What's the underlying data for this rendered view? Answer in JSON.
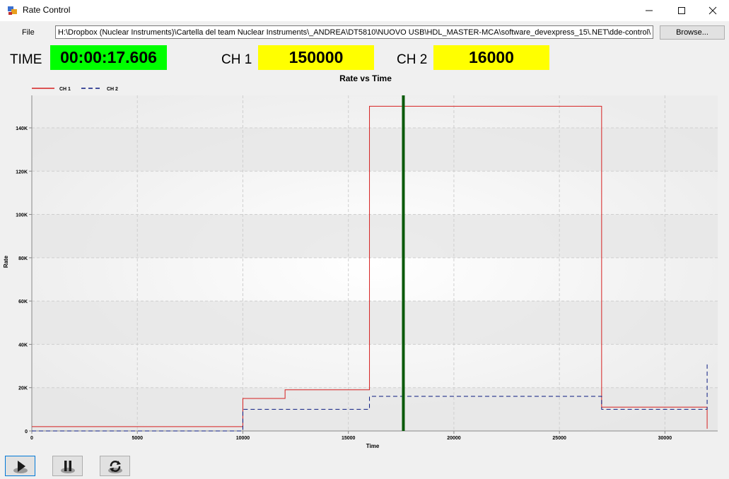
{
  "window": {
    "title": "Rate Control",
    "minimize": "—",
    "maximize": "☐",
    "close": "✕"
  },
  "file": {
    "label": "File",
    "path": "H:\\Dropbox (Nuclear Instruments)\\Cartella del team Nuclear Instruments\\_ANDREA\\DT5810\\NUOVO USB\\HDL_MASTER-MCA\\software_devexpress_15\\.NET\\dde-control\\bin",
    "browse_label": "Browse..."
  },
  "readouts": {
    "time_label": "TIME",
    "time_value": "00:00:17.606",
    "ch1_label": "CH 1",
    "ch1_value": "150000",
    "ch2_label": "CH 2",
    "ch2_value": "16000"
  },
  "colors": {
    "time_bg": "#00ff00",
    "ch_bg": "#ffff00",
    "ch1_line": "#d62020",
    "ch2_line": "#0a1a80",
    "cursor": "#0a5a0a"
  },
  "chart_data": {
    "type": "line",
    "title": "Rate vs Time",
    "xlabel": "Time",
    "ylabel": "Rate",
    "xlim": [
      0,
      32500
    ],
    "ylim": [
      0,
      150000
    ],
    "xticks": [
      0,
      5000,
      10000,
      15000,
      20000,
      25000,
      30000
    ],
    "yticks": [
      0,
      20000,
      40000,
      60000,
      80000,
      100000,
      120000,
      140000
    ],
    "ytick_labels": [
      "0",
      "20K",
      "40K",
      "60K",
      "80K",
      "100K",
      "120K",
      "140K"
    ],
    "legend_position": "top-left",
    "cursor_x": 17606,
    "series": [
      {
        "name": "CH 1",
        "style": "solid",
        "x": [
          0,
          10000,
          10000,
          12000,
          12000,
          16000,
          16000,
          27000,
          27000,
          32000,
          32000
        ],
        "y": [
          2000,
          2000,
          15000,
          15000,
          19000,
          19000,
          150000,
          150000,
          11000,
          11000,
          1000
        ]
      },
      {
        "name": "CH 2",
        "style": "dashed",
        "x": [
          0,
          10000,
          10000,
          16000,
          16000,
          27000,
          27000,
          32000,
          32000
        ],
        "y": [
          0,
          0,
          10000,
          10000,
          16000,
          16000,
          10000,
          10000,
          31000
        ]
      }
    ]
  },
  "controls": {
    "play": "play-icon",
    "pause": "pause-icon",
    "reset": "refresh-icon"
  }
}
